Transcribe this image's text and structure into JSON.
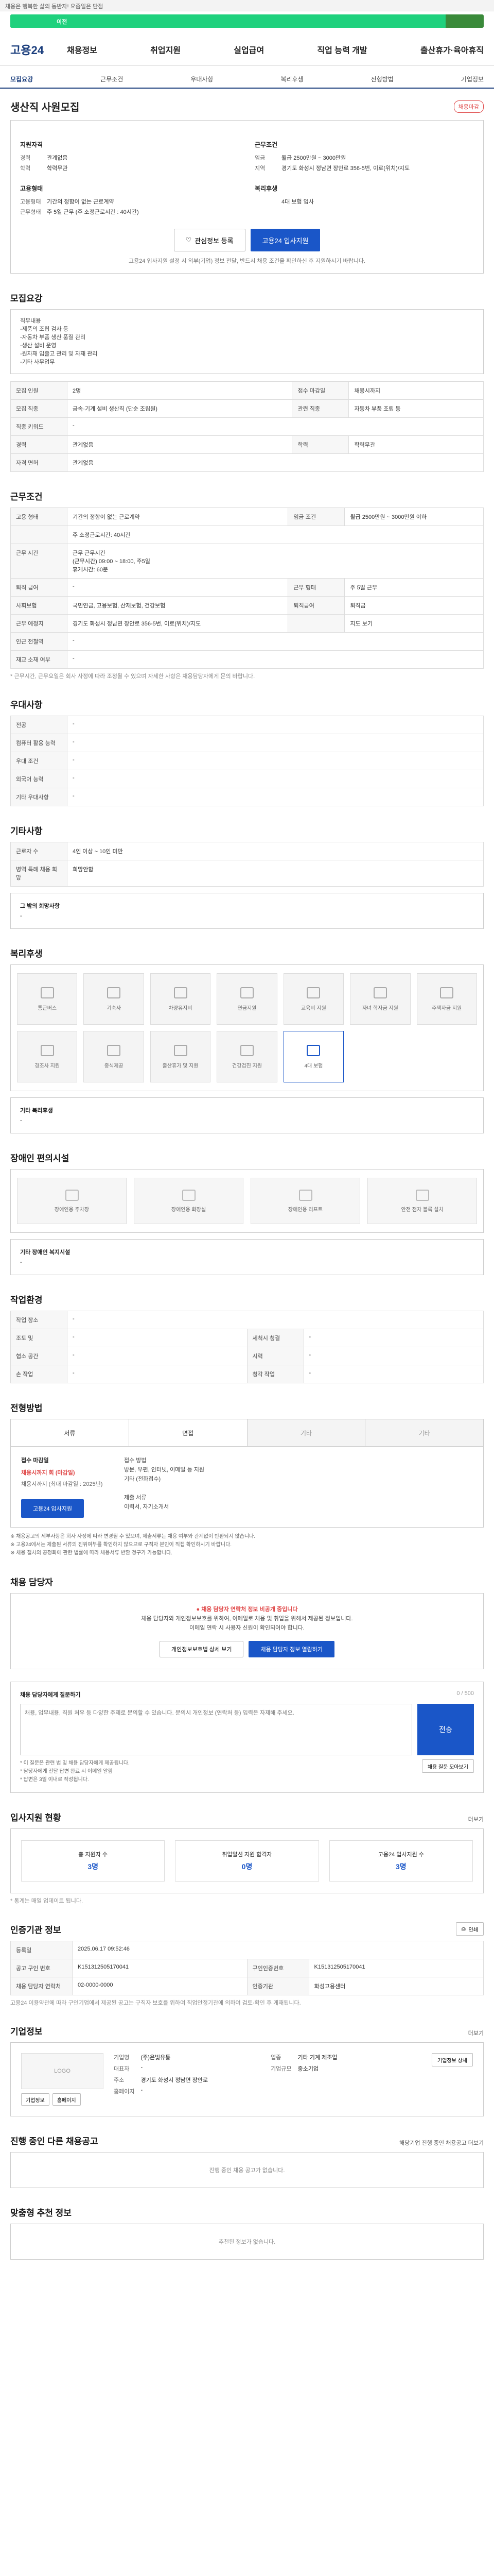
{
  "top_note": "채용은 행복한 삶의 동반자! 요즘일은 단점",
  "progress": {
    "label": "이전",
    "fraction": 0.92
  },
  "brand": {
    "logo": "고용24",
    "accent": "#1a56c8",
    "navy": "#1a3d7c"
  },
  "gnb": [
    "채용정보",
    "취업지원",
    "실업급여",
    "직업 능력 개발",
    "출산휴가·육아휴직"
  ],
  "snb": [
    "모집요강",
    "근무조건",
    "우대사항",
    "복리후생",
    "전형방법",
    "기업정보"
  ],
  "job": {
    "title": "생산직 사원모집",
    "status_badge": "채용마감",
    "company_label": "지원자격",
    "left": [
      {
        "k": "경력",
        "v": "관계없음"
      },
      {
        "k": "학력",
        "v": "학력무관"
      }
    ],
    "left2_label": "고용형태",
    "left2": [
      {
        "k": "고용형태",
        "v": "기간의 정함이 없는 근로계약"
      },
      {
        "k": "근무형태",
        "v": "주 5일 근무 (주 소정근로시간 : 40시간)"
      }
    ],
    "right_label": "근무조건",
    "right": [
      {
        "k": "임금",
        "v": "월급 2500만원 ~ 3000만원"
      },
      {
        "k": "지역",
        "v": "경기도 화성시 정남면 장안로 356-5번, 이로(위치)/지도"
      }
    ],
    "right2_label": "복리후생",
    "right2": [
      {
        "k": "",
        "v": "4대 보험 입사"
      }
    ],
    "save_label": "관심정보 등록",
    "apply_label": "고용24 입사지원",
    "note": "고용24 입사지원 설정 시 외부(기업) 정보 전달, 반드시 채용 조건을 확인하신 후 지원하시기 바랍니다."
  },
  "recruit": {
    "title": "모집요강",
    "desc_label": "직무내용",
    "desc": "직무내용\n-제품의 조립 검사 등\n-자동차 부품 생산 품질 관리\n-생산 설비 운영\n-원자재 입출고 관리 및 자재 관리\n-기타 사무업무",
    "rows": [
      [
        "모집 인원",
        "2명",
        "접수 마감일",
        "채용시까지"
      ],
      [
        "모집 직종",
        "금속·기계 설비 생산직 (단순 조립원)",
        "관련 직종",
        "자동차 부품 조립 등"
      ],
      [
        "직종 키워드",
        "-",
        "",
        ""
      ],
      [
        "경력",
        "관계없음",
        "학력",
        "학력무관"
      ],
      [
        "자격 면허",
        "관계없음",
        "",
        ""
      ]
    ]
  },
  "conditions": {
    "title": "근무조건",
    "rows": [
      [
        "고용 형태",
        "기간의 정함이 없는 근로계약",
        "임금 조건",
        "월급 2500만원 ~ 3000만원 이하"
      ],
      [
        "",
        "주 소정근로시간: 40시간",
        "",
        ""
      ],
      [
        "근무 시간",
        "근무 근무시간\n(근무시간) 09:00 ~ 18:00, 주5일\n휴게시간: 60분",
        "",
        ""
      ],
      [
        "퇴직 급여",
        "-",
        "근무 형태",
        "주 5일 근무"
      ],
      [
        "사회보험",
        "국민연금, 고용보험, 산재보험, 건강보험",
        "퇴직급여",
        "퇴직금"
      ],
      [
        "근무 예정지",
        "경기도 화성시 정남면 장안로 356-5번, 이로(위치)/지도",
        "",
        "지도 보기"
      ],
      [
        "인근 전철역",
        "-",
        "",
        ""
      ],
      [
        "재교 소재 여부",
        "-",
        "",
        ""
      ]
    ],
    "note": "* 근무시간, 근무요일은 회사 사정에 따라 조정될 수 있으며 자세한 사항은 채용담당자에게 문의 바랍니다."
  },
  "prefer": {
    "title": "우대사항",
    "rows": [
      [
        "전공",
        "-"
      ],
      [
        "컴퓨터 활용 능력",
        "-"
      ],
      [
        "우대 조건",
        "-"
      ],
      [
        "외국어 능력",
        "-"
      ],
      [
        "기타 우대사항",
        "-"
      ]
    ]
  },
  "other": {
    "title": "기타사항",
    "rows": [
      [
        "근로자 수",
        "4인 이상 ~ 10인 미만"
      ],
      [
        "병역 특례 채용 희망",
        "희망안함"
      ]
    ],
    "etc_label": "그 밖의 희망사항",
    "etc": "-"
  },
  "welfare": {
    "title": "복리후생",
    "items": [
      {
        "label": "통근버스",
        "on": false
      },
      {
        "label": "기숙사",
        "on": false
      },
      {
        "label": "차량유지비",
        "on": false
      },
      {
        "label": "연금지원",
        "on": false
      },
      {
        "label": "교육비 지원",
        "on": false
      },
      {
        "label": "자녀 학자금 지원",
        "on": false
      },
      {
        "label": "주택자금 지원",
        "on": false
      },
      {
        "label": "경조사 지원",
        "on": false
      },
      {
        "label": "중식제공",
        "on": false
      },
      {
        "label": "출산휴가 및 지원",
        "on": false
      },
      {
        "label": "건강검진 지원",
        "on": false
      },
      {
        "label": "4대 보험",
        "on": true
      }
    ],
    "other_label": "기타 복리후생",
    "other": "-"
  },
  "disability": {
    "title": "장애인 편의시설",
    "items": [
      "장애인용 주차장",
      "장애인용 화장실",
      "장애인용 리프트",
      "안전 점자 블록 설치"
    ],
    "other_label": "기타 장애인 복지시설",
    "other": "-"
  },
  "workenv": {
    "title": "작업환경",
    "rows": [
      [
        "작업 장소",
        "-",
        "",
        ""
      ],
      [
        "조도 및",
        "-",
        "세척시 청결",
        "-"
      ],
      [
        "협소 공간",
        "-",
        "시력",
        "-"
      ],
      [
        "손 작업",
        "-",
        "청각 작업",
        "-"
      ]
    ]
  },
  "process": {
    "title": "전형방법",
    "tabs": [
      "서류",
      "면접",
      "기타",
      "기타"
    ],
    "left": [
      [
        "접수 마감일",
        "채용시까지 회 (마감일)"
      ],
      [
        "",
        "채용시까지 (최대 마감일 : 2025년)"
      ]
    ],
    "apply_btn": "고용24 입사지원",
    "right": "접수 방법\n방문, 우편, 인터넷, 이메일 등 지원\n기타 (전화접수)\n\n제출 서류\n이력서, 자기소개서",
    "bullets": "※ 채용공고의 세부사항은 회사 사정에 따라 변경될 수 있으며, 제출서류는 채용 여부와 관계없이 반환되지 않습니다.\n※ 고용24에서는 제출된 서류의 진위여부를 확인하지 않으므로 구직자 본인이 직접 확인하시기 바랍니다.\n※ 채용 절차의 공정화에 관한 법률에 따라 채용서류 반환 청구가 가능합니다."
  },
  "contact": {
    "title": "채용 담당자",
    "warn": "채용 담당자 연락처 정보 비공개 중입니다",
    "line1": "채용 담당자와 개인정보보호를 위하여, 이메일로 채용 및 취업을 위해서 제공된 정보입니다.",
    "line2": "이메일 연락 시 사용자 신원이 확인되어야 합니다.",
    "btn1": "개인정보보호법 상세 보기",
    "btn2": "채용 담당자 정보 열람하기"
  },
  "question": {
    "label": "채용 담당자에게 질문하기",
    "counter": "0 / 500",
    "placeholder": "채용, 업무내용, 직원 처우 등 다양한 주제로 문의할 수 있습니다. 문의시 개인정보 (연락처 등) 입력은 자제해 주세요.",
    "send": "전송",
    "notes": "* 이 질문은 관련 법 및 채용 담당자에게 제공됩니다.\n* 담당자에게 전달 답변 완료 시 이메일 알림\n* 답변은 3일 이내로 작성됩니다.",
    "more": "채용 질문 모아보기"
  },
  "stats": {
    "title": "입사지원 현황",
    "more": "더보기",
    "items": [
      {
        "label": "총 지원자 수",
        "value": "3명"
      },
      {
        "label": "취업알선 지원 합격자",
        "value": "0명"
      },
      {
        "label": "고용24 입사지원 수",
        "value": "3명"
      }
    ],
    "note": "* 통계는 매일 업데이트 됩니다."
  },
  "info": {
    "title": "인증기관 정보",
    "print_label": "인쇄",
    "rows": [
      [
        "등록일",
        "2025.06.17 09:52:46",
        "",
        ""
      ],
      [
        "공고 구인 번호",
        "K151312505170041",
        "구인인증번호",
        "K151312505170041"
      ],
      [
        "채용 담당자 연락처",
        "02-0000-0000",
        "인증기관",
        "화성고용센터"
      ]
    ],
    "note": "고용24 이용약관에 따라 구인기업에서 제공된 공고는 구직자 보호를 위하여 직업안정기관에 의하여 검토·확인 후 게재됩니다."
  },
  "company": {
    "title": "기업정보",
    "more": "더보기",
    "logo_alt": "LOGO",
    "buttons": [
      "기업정보",
      "홈페이지"
    ],
    "fields": [
      [
        "기업명",
        "(주)은빛유통",
        "업종",
        "기타 기계 제조업"
      ],
      [
        "대표자",
        "-",
        "기업규모",
        "중소기업"
      ],
      [
        "주소",
        "경기도 화성시 정남면 장안로",
        "",
        ""
      ],
      [
        "홈페이지",
        "-",
        "",
        ""
      ]
    ],
    "detail_btn": "기업정보 상세"
  },
  "other_jobs": {
    "title": "진행 중인 다른 채용공고",
    "more": "해당기업 진행 중인 채용공고 더보기",
    "empty": "진행 중인 채용 공고가 없습니다."
  },
  "recommended": {
    "title": "맞춤형 추천 정보",
    "more": "",
    "empty": "추천된 정보가 없습니다."
  }
}
